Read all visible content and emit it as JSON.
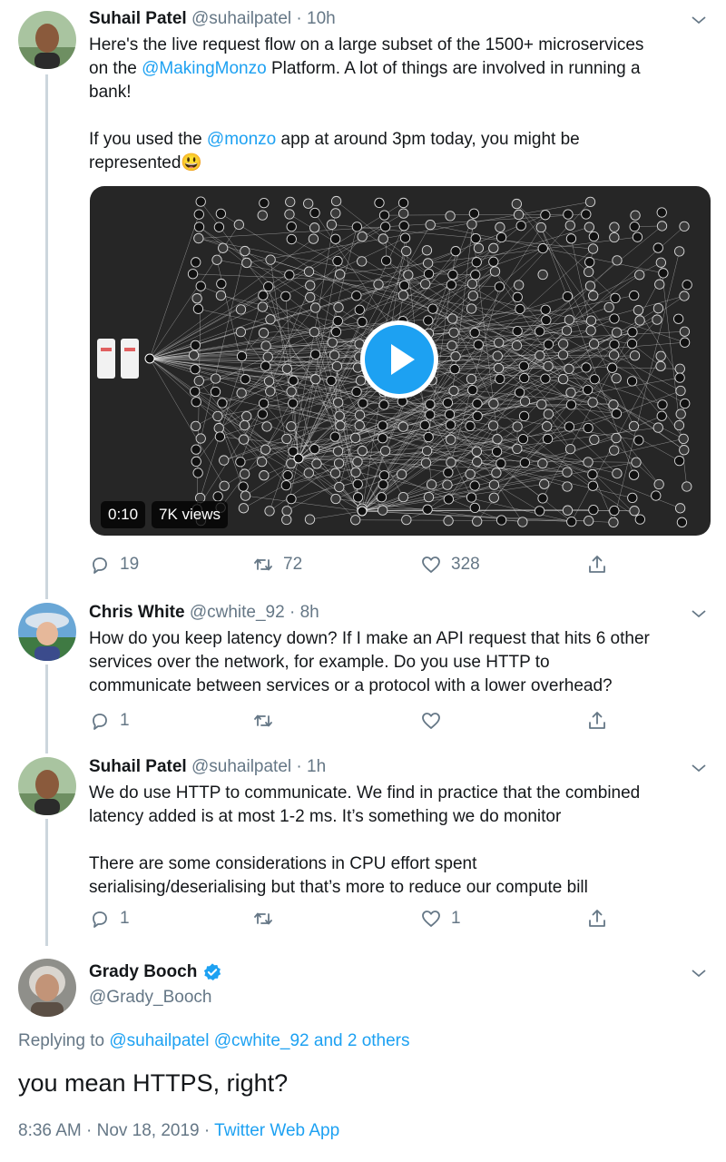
{
  "tweets": [
    {
      "name": "Suhail Patel",
      "handle": "@suhailpatel",
      "time": "· 10h",
      "text_line1_a": "Here's the live request flow on a large subset of the 1500+ microservices",
      "text_line2_a": "on the ",
      "text_line2_mention": "@MakingMonzo",
      "text_line2_b": " Platform. A lot of things are involved in running a",
      "text_line3": "bank!",
      "text_line4_a": "If you used the ",
      "text_line4_mention": "@monzo",
      "text_line4_b": " app at around 3pm today, you might be",
      "text_line5": "represented",
      "emoji": "😃",
      "video": {
        "duration": "0:10",
        "views": "7K views"
      },
      "reply_count": "19",
      "retweet_count": "72",
      "like_count": "328"
    },
    {
      "name": "Chris White",
      "handle": "@cwhite_92",
      "time": "· 8h",
      "line1": "How do you keep latency down? If I make an API request that hits 6 other",
      "line2": "services over the network, for example. Do you use HTTP to",
      "line3": "communicate between services or a protocol with a lower overhead?",
      "reply_count": "1",
      "retweet_count": "",
      "like_count": ""
    },
    {
      "name": "Suhail Patel",
      "handle": "@suhailpatel",
      "time": "· 1h",
      "line1": "We do use HTTP to communicate. We find in practice that the combined",
      "line2": "latency added is at most 1-2 ms. It’s something we do monitor",
      "line3": "There are some considerations in CPU effort spent",
      "line4": "serialising/deserialising but that’s more to reduce our compute bill",
      "reply_count": "1",
      "retweet_count": "",
      "like_count": "1"
    }
  ],
  "main_tweet": {
    "name": "Grady Booch",
    "handle": "@Grady_Booch",
    "replying_prefix": "Replying to ",
    "replying_mentions": "@suhailpatel @cwhite_92 and 2 others",
    "text": "you mean HTTPS, right?",
    "timestamp": "8:36 AM · Nov 18, 2019 · ",
    "app": "Twitter Web App"
  },
  "colors": {
    "accent": "#1da1f2",
    "secondary_text": "#657786",
    "thread_line": "#ccd6dd",
    "verified": "#1da1f2"
  },
  "icons": [
    "chevron-down-icon",
    "reply-icon",
    "retweet-icon",
    "like-icon",
    "share-icon",
    "play-icon",
    "verified-badge-icon"
  ]
}
